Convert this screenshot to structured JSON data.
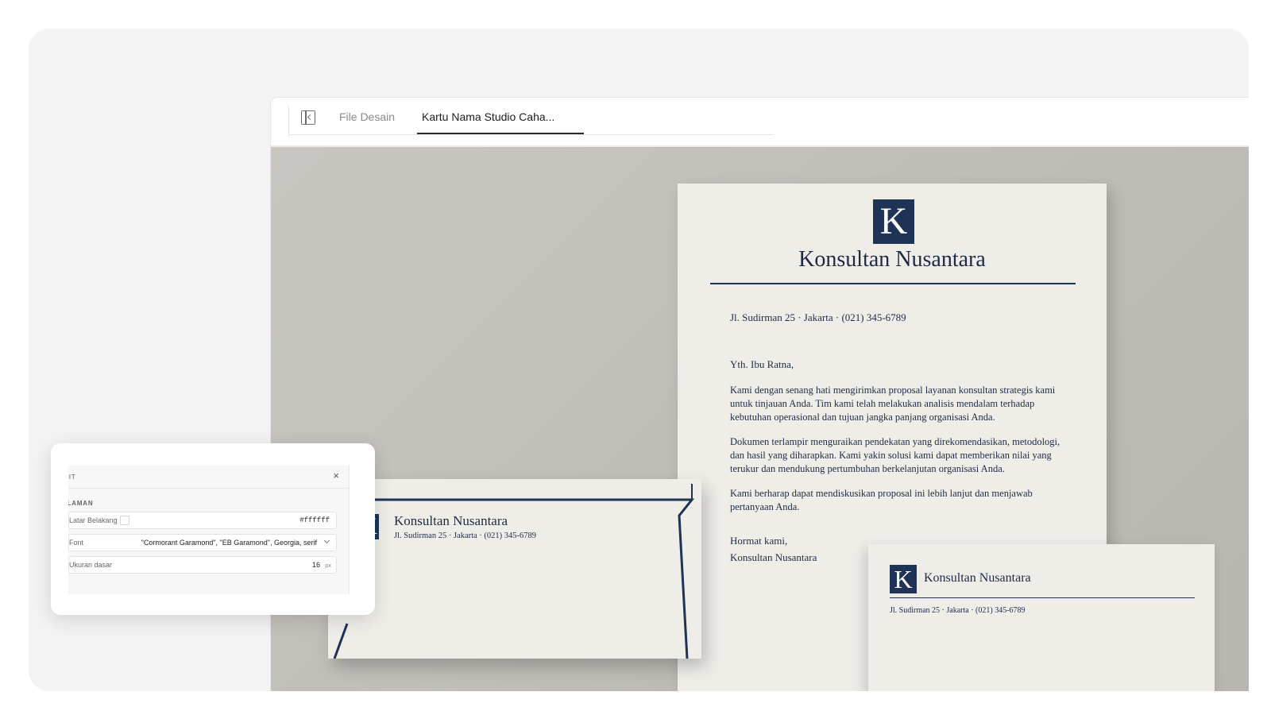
{
  "tabs": {
    "files_label": "File Desain",
    "active_label": "Kartu Nama Studio Caha..."
  },
  "brand": {
    "logo_letter": "K",
    "company": "Konsultan Nusantara",
    "address": "Jl. Sudirman 25 · Jakarta · (021) 345-6789",
    "accent_color": "#1f3356"
  },
  "letter": {
    "salutation": "Yth. Ibu Ratna,",
    "paragraphs": [
      "Kami dengan senang hati mengirimkan proposal layanan konsultan strategis kami untuk tinjauan Anda. Tim kami telah melakukan analisis mendalam terhadap kebutuhan operasional dan tujuan jangka panjang organisasi Anda.",
      "Dokumen terlampir menguraikan pendekatan yang direkomendasikan, metodologi, dan hasil yang diharapkan. Kami yakin solusi kami dapat memberikan nilai yang terukur dan mendukung pertumbuhan berkelanjutan organisasi Anda.",
      "Kami berharap dapat mendiskusikan proposal ini lebih lanjut dan menjawab pertanyaan Anda."
    ],
    "closing": "Hormat kami,",
    "signature": "Konsultan Nusantara"
  },
  "panel": {
    "title": "DIT",
    "close_glyph": "×",
    "section": "ALAMAN",
    "rows": [
      {
        "label": "Latar Belakang",
        "value": "#ffffff"
      },
      {
        "label": "Font",
        "value": "\"Cormorant Garamond\", \"EB Garamond\", Georgia, serif"
      },
      {
        "label": "Ukuran dasar",
        "value": "16",
        "unit": "px"
      }
    ]
  }
}
